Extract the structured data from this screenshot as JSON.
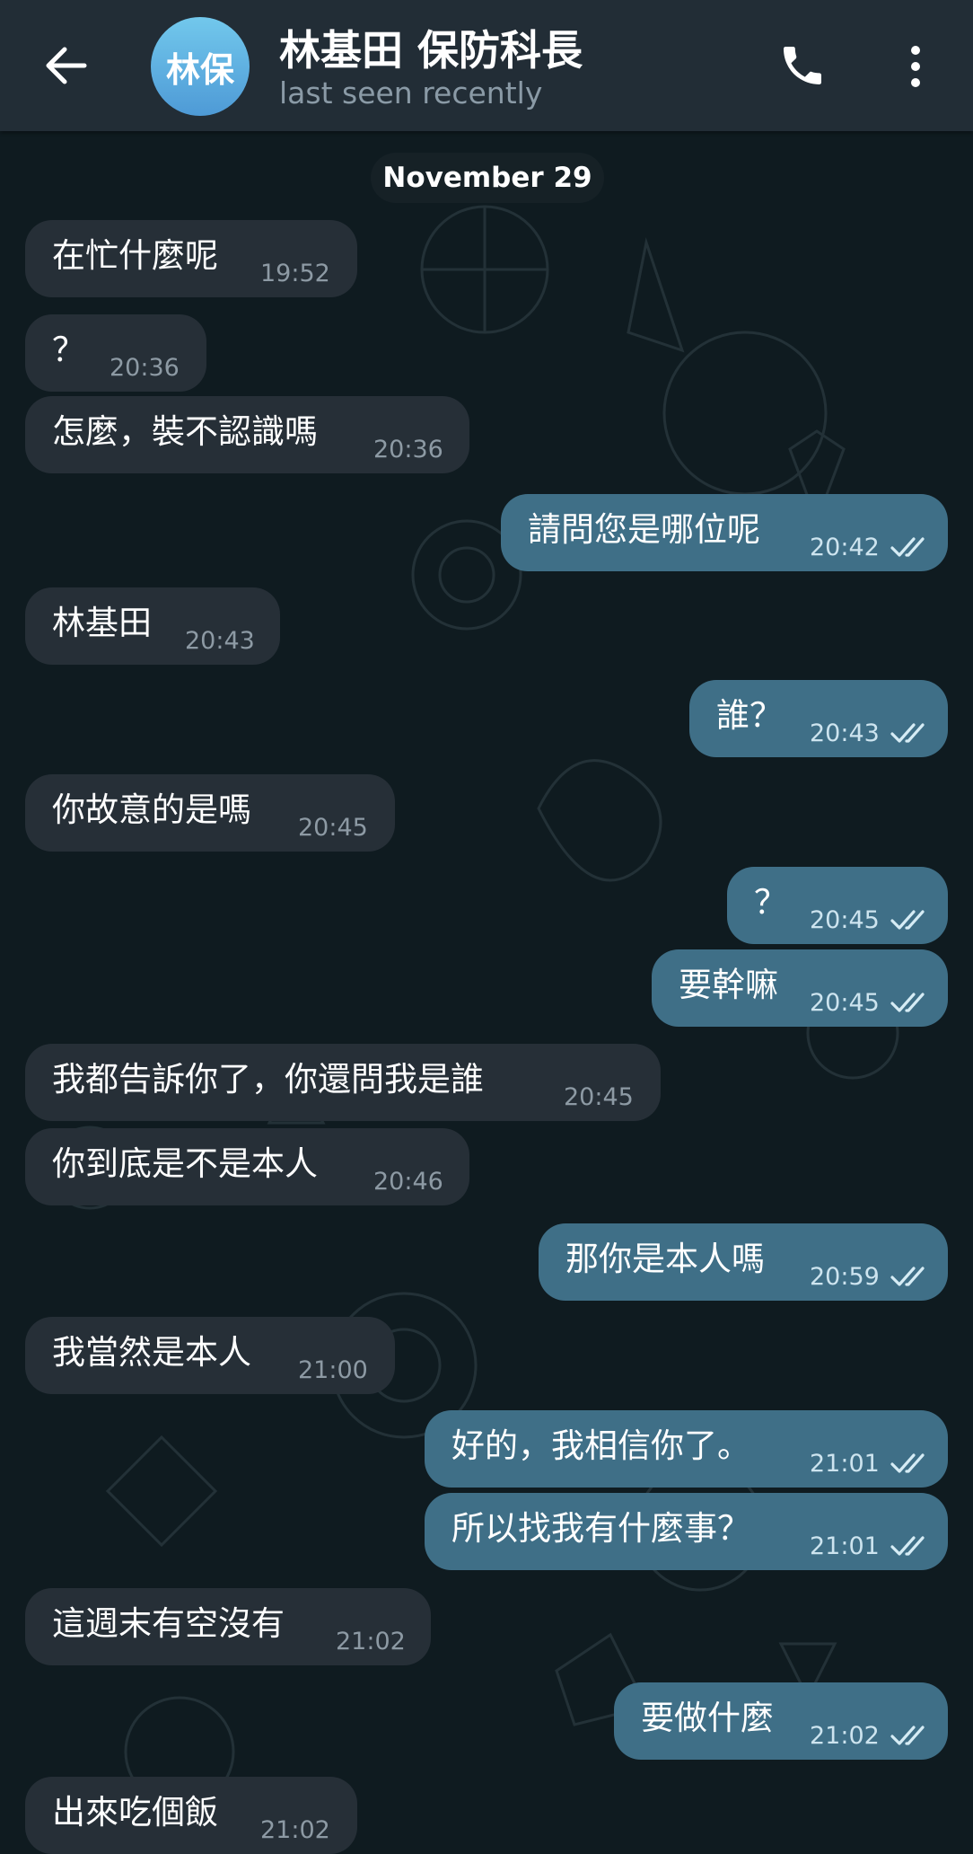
{
  "header": {
    "avatar_text": "林保",
    "title": "林基田 保防科長",
    "status": "last seen recently"
  },
  "date_separator": "November 29",
  "messages": [
    {
      "dir": "in",
      "text": "在忙什麼呢",
      "time": "19:52"
    },
    {
      "dir": "in",
      "text": "？",
      "time": "20:36"
    },
    {
      "dir": "in",
      "text": "怎麼，裝不認識嗎",
      "time": "20:36"
    },
    {
      "dir": "out",
      "text": "請問您是哪位呢",
      "time": "20:42",
      "status": "read"
    },
    {
      "dir": "in",
      "text": "林基田",
      "time": "20:43"
    },
    {
      "dir": "out",
      "text": "誰？",
      "time": "20:43",
      "status": "read"
    },
    {
      "dir": "in",
      "text": "你故意的是嗎",
      "time": "20:45"
    },
    {
      "dir": "out",
      "text": "？",
      "time": "20:45",
      "status": "read"
    },
    {
      "dir": "out",
      "text": "要幹嘛",
      "time": "20:45",
      "status": "read"
    },
    {
      "dir": "in",
      "text": "我都告訴你了，你還問我是誰",
      "time": "20:45"
    },
    {
      "dir": "in",
      "text": "你到底是不是本人",
      "time": "20:46"
    },
    {
      "dir": "out",
      "text": "那你是本人嗎",
      "time": "20:59",
      "status": "read"
    },
    {
      "dir": "in",
      "text": "我當然是本人",
      "time": "21:00"
    },
    {
      "dir": "out",
      "text": "好的，我相信你了。",
      "time": "21:01",
      "status": "read"
    },
    {
      "dir": "out",
      "text": "所以找我有什麼事？",
      "time": "21:01",
      "status": "read"
    },
    {
      "dir": "in",
      "text": "這週末有空沒有",
      "time": "21:02"
    },
    {
      "dir": "out",
      "text": "要做什麼",
      "time": "21:02",
      "status": "read"
    },
    {
      "dir": "in",
      "text": "出來吃個飯",
      "time": "21:02"
    }
  ],
  "colors": {
    "background": "#0f1b20",
    "header": "#222d36",
    "incoming_bubble": "#262f37",
    "outgoing_bubble": "#3f6f87",
    "avatar_gradient_top": "#72c8ec",
    "avatar_gradient_bottom": "#4e9ad6"
  },
  "icons": {
    "back": "arrow-left-icon",
    "call": "phone-icon",
    "menu": "more-vertical-icon",
    "read_status": "double-check-icon"
  }
}
